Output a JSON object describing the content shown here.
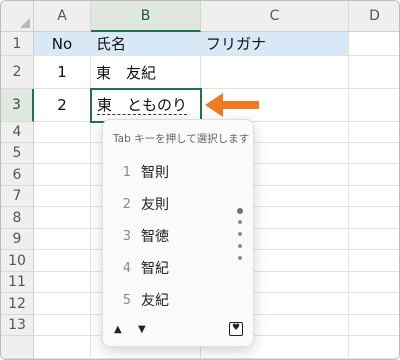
{
  "sheet": {
    "columns": [
      "A",
      "B",
      "C",
      "D"
    ],
    "rows": [
      "1",
      "2",
      "3",
      "4",
      "5",
      "6",
      "7",
      "8",
      "9",
      "10",
      "11",
      "12",
      "13"
    ],
    "cells": {
      "A1": "No",
      "B1": "氏名",
      "C1": "フリガナ",
      "A2": "1",
      "B2": "東　友紀",
      "A3": "2",
      "B3": "東　とものり"
    },
    "active_cell": "B3"
  },
  "ime": {
    "hint": "Tab キーを押して選択します",
    "candidates": [
      {
        "num": "1",
        "text": "智則"
      },
      {
        "num": "2",
        "text": "友則"
      },
      {
        "num": "3",
        "text": "智徳"
      },
      {
        "num": "4",
        "text": "智紀"
      },
      {
        "num": "5",
        "text": "友紀"
      }
    ],
    "up_label": "▲",
    "down_label": "▼",
    "favorite_icon": "♥"
  },
  "colors": {
    "accent": "#217346",
    "header_fill": "#d9e8f7",
    "arrow": "#f07a1f"
  }
}
